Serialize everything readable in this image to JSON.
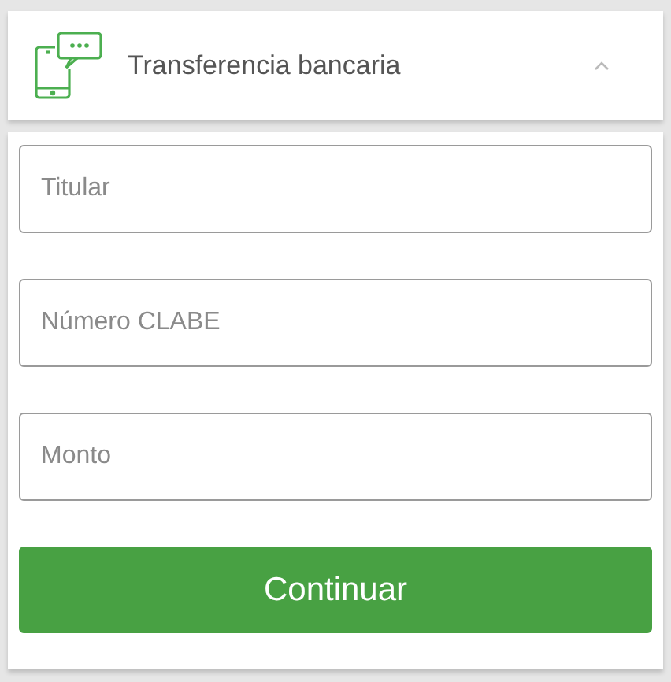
{
  "header": {
    "title": "Transferencia bancaria",
    "expanded": true
  },
  "fields": [
    {
      "placeholder": "Titular"
    },
    {
      "placeholder": "Número CLABE"
    },
    {
      "placeholder": "Monto"
    }
  ],
  "button": "Continuar"
}
